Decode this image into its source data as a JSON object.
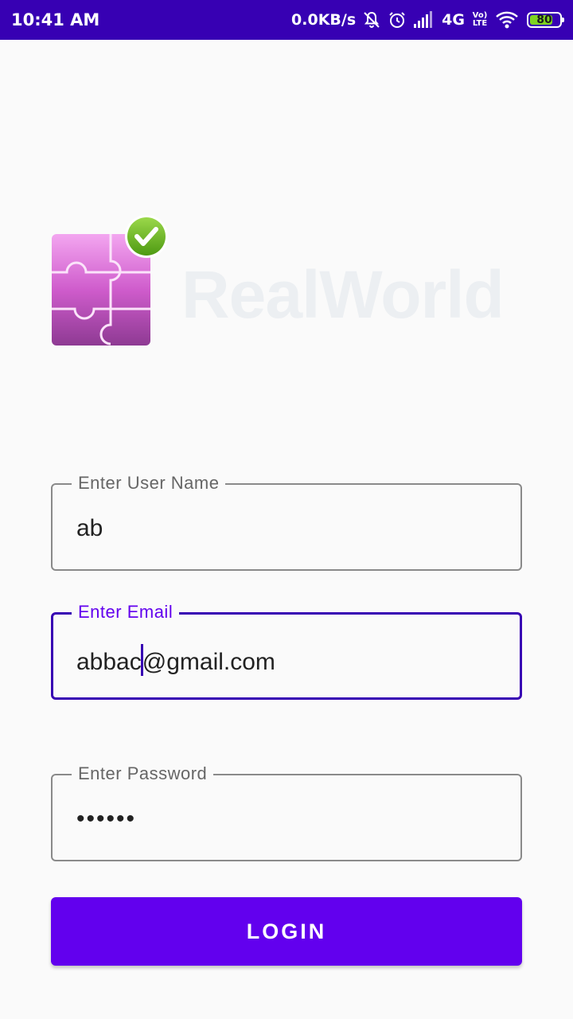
{
  "status_bar": {
    "time": "10:41 AM",
    "data_speed": "0.0KB/s",
    "network": "4G",
    "volte": "Vo) LTE",
    "battery": "80",
    "icons": [
      "mute-bell-icon",
      "alarm-icon",
      "signal-icon",
      "wifi-icon",
      "battery-icon"
    ]
  },
  "brand": {
    "name": "RealWorld",
    "logo_icon": "puzzle-check-icon"
  },
  "form": {
    "username": {
      "label": "Enter User Name",
      "value": "ab"
    },
    "email": {
      "label": "Enter Email",
      "value_before_caret": "abbac",
      "value_after_caret": "@gmail.com"
    },
    "password": {
      "label": "Enter Password",
      "value": "••••••"
    }
  },
  "login_button": {
    "label": "LOGIN"
  },
  "colors": {
    "status_bar": "#3700b3",
    "primary": "#6200ee",
    "focused_border": "#3700b3",
    "background": "#fafafa"
  }
}
